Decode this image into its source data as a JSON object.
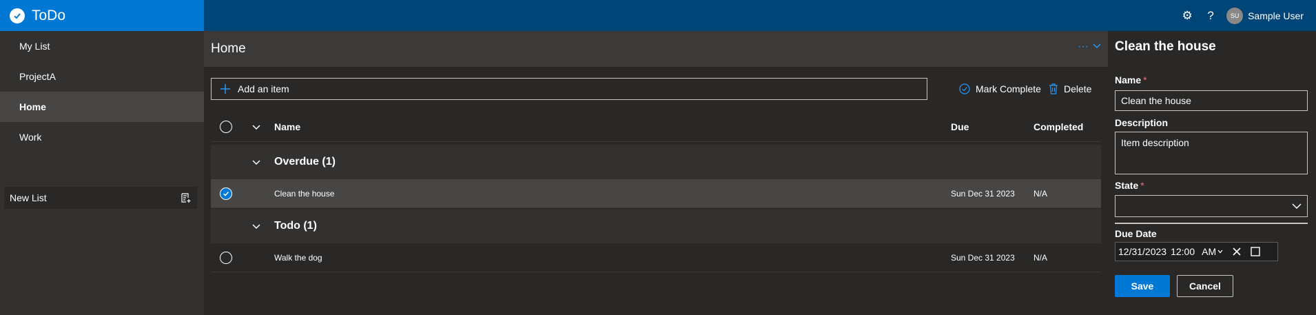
{
  "app": {
    "title": "ToDo"
  },
  "header": {
    "settings_icon": "gear-icon",
    "help_icon": "help-icon",
    "user": {
      "initials": "SU",
      "name": "Sample User"
    }
  },
  "sidebar": {
    "items": [
      {
        "label": "My List"
      },
      {
        "label": "ProjectA"
      },
      {
        "label": "Home"
      },
      {
        "label": "Work"
      }
    ],
    "active": "Home",
    "new_list": {
      "placeholder": "New List"
    }
  },
  "main": {
    "title": "Home",
    "add_item": {
      "label": "Add an item"
    },
    "commands": {
      "mark_complete": "Mark Complete",
      "delete": "Delete"
    },
    "columns": {
      "name": "Name",
      "due": "Due",
      "completed": "Completed"
    },
    "groups": [
      {
        "title": "Overdue (1)",
        "items": [
          {
            "name": "Clean the house",
            "due": "Sun Dec 31 2023",
            "completed": "N/A",
            "selected": true
          }
        ]
      },
      {
        "title": "Todo (1)",
        "items": [
          {
            "name": "Walk the dog",
            "due": "Sun Dec 31 2023",
            "completed": "N/A",
            "selected": false
          }
        ]
      }
    ]
  },
  "panel": {
    "title": "Clean the house",
    "name_label": "Name",
    "name_value": "Clean the house",
    "description_label": "Description",
    "description_value": "Item description",
    "state_label": "State",
    "state_value": "",
    "due_label": "Due Date",
    "due_value": {
      "date": "12/31/2023",
      "time": "12:00",
      "ampm": "AM"
    },
    "save": "Save",
    "cancel": "Cancel"
  },
  "colors": {
    "accent": "#0078d4",
    "topbar": "#004578",
    "required": "#f1707b"
  }
}
